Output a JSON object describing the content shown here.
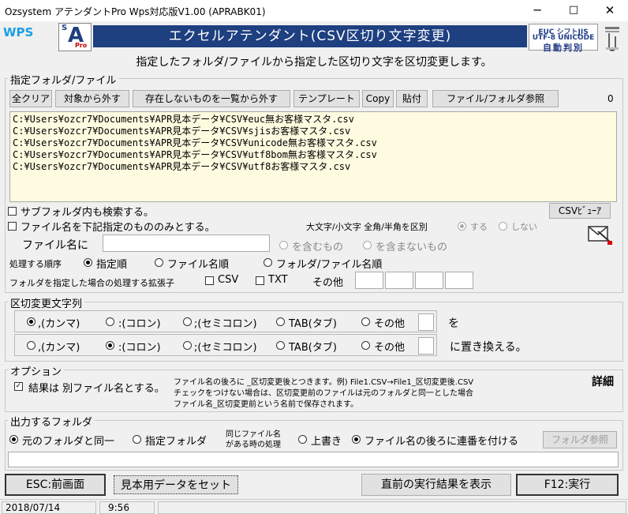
{
  "window": {
    "title": "Ozsystem アテンダントPro Wps対応版V1.00 (APRABK01)",
    "minimize": "─",
    "maximize": "□",
    "close": "✕"
  },
  "logos": {
    "wps": "WPS",
    "sa_s": "S",
    "sa_a": "A",
    "sa_pro": "Pro"
  },
  "banner": {
    "title": "エクセルアテンダント(CSV区切り文字変更)",
    "enc_line1": "EUC  シフトJIS",
    "enc_line2": "UTF-8 UNICODE",
    "enc_line3": "自動判別"
  },
  "subtitle": "指定したフォルダ/ファイルから指定した区切り文字を区切変更します。",
  "folder_group": {
    "legend": "指定フォルダ/ファイル",
    "buttons": {
      "clear_all": "全クリア",
      "remove_target": "対象から外す",
      "remove_missing": "存在しないものを一覧から外す",
      "template": "テンプレート",
      "copy": "Copy",
      "paste": "貼付",
      "browse": "ファイル/フォルダ参照"
    },
    "count": "0",
    "files": [
      "C:¥Users¥ozcr7¥Documents¥APR見本データ¥CSV¥euc無お客様マスタ.csv",
      "C:¥Users¥ozcr7¥Documents¥APR見本データ¥CSV¥sjisお客様マスタ.csv",
      "C:¥Users¥ozcr7¥Documents¥APR見本データ¥CSV¥unicode無お客様マスタ.csv",
      "C:¥Users¥ozcr7¥Documents¥APR見本データ¥CSV¥utf8bom無お客様マスタ.csv",
      "C:¥Users¥ozcr7¥Documents¥APR見本データ¥CSV¥utf8お客様マスタ.csv"
    ],
    "search_subfolders": "サブフォルダ内も検索する。",
    "filter_filename": "ファイル名を下記指定のもののみとする。",
    "csv_viewer": "CSVﾋﾞｭｰｱ",
    "case_label": "大文字/小文字 全角/半角を区別",
    "case_yes": "する",
    "case_no": "しない",
    "filename_label": "ファイル名に",
    "filename_value": "",
    "include": "を含むもの",
    "exclude": "を含まないもの",
    "order_label": "処理する順序",
    "order_specified": "指定順",
    "order_filename": "ファイル名順",
    "order_folder": "フォルダ/ファイル名順",
    "ext_label": "フォルダを指定した場合の処理する拡張子",
    "ext_csv": "CSV",
    "ext_txt": "TXT",
    "ext_other": "その他"
  },
  "delim_group": {
    "legend": "区切変更文字列",
    "from": {
      "comma": ",(カンマ)",
      "colon": ":(コロン)",
      "semicolon": ";(セミコロン)",
      "tab": "TAB(タブ)",
      "other": "その他",
      "suffix": "を"
    },
    "to": {
      "comma": ",(カンマ)",
      "colon": ":(コロン)",
      "semicolon": ";(セミコロン)",
      "tab": "TAB(タブ)",
      "other": "その他",
      "suffix": "に置き換える。"
    }
  },
  "option_group": {
    "legend": "オプション",
    "separate_file": "結果は 別ファイル名とする。",
    "desc_line1": "ファイル名の後ろに _区切変更後とつきます。例) File1.CSV→File1_区切変更後.CSV",
    "desc_line2": "チェックをつけない場合は、区切変更前のファイルは元のフォルダと同一とした場合",
    "desc_line3": "ファイル名_区切変更前という名前で保存されます。",
    "detail": "詳細"
  },
  "output_group": {
    "legend": "出力するフォルダ",
    "same_folder": "元のフォルダと同一",
    "specified_folder": "指定フォルダ",
    "same_name_line1": "同じファイル名",
    "same_name_line2": "がある時の処理",
    "overwrite": "上書き",
    "add_serial": "ファイル名の後ろに連番を付ける",
    "folder_browse": "フォルダ参照",
    "path_value": ""
  },
  "bottom_buttons": {
    "esc": "ESC:前画面",
    "sample": "見本用データをセット",
    "show_last": "直前の実行結果を表示",
    "f12": "F12:実行"
  },
  "status": {
    "date": "2018/07/14",
    "time": "9:56"
  },
  "colors": {
    "banner": "#1e3f80",
    "file_list_bg": "#fefbe0"
  }
}
